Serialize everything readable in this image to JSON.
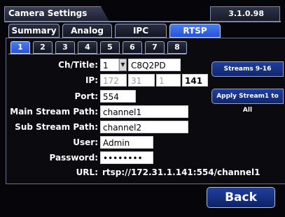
{
  "window": {
    "title": "Camera Settings",
    "version": "3.1.0.98"
  },
  "main_tabs": [
    {
      "label": "Summary"
    },
    {
      "label": "Analog"
    },
    {
      "label": "IPC"
    },
    {
      "label": "RTSP"
    }
  ],
  "active_main_tab": "RTSP",
  "channel_tabs": [
    "1",
    "2",
    "3",
    "4",
    "5",
    "6",
    "7",
    "8"
  ],
  "active_channel_tab": "1",
  "form": {
    "ch_title_label": "Ch/Title:",
    "ch_value": "1",
    "title_value": "C8Q2PD",
    "ip_label": "IP:",
    "ip_octets": [
      "172",
      "31",
      "1",
      "141"
    ],
    "port_label": "Port:",
    "port_value": "554",
    "main_stream_label": "Main Stream Path:",
    "main_stream_value": "channel1",
    "sub_stream_label": "Sub Stream Path:",
    "sub_stream_value": "channel2",
    "user_label": "User:",
    "user_value": "Admin",
    "password_label": "Password:",
    "password_value": "••••••••",
    "url_label": "URL:",
    "url_value": "rtsp://172.31.1.141:554/channel1"
  },
  "side_buttons": {
    "streams_label": "Streams 9-16",
    "apply_label": "Apply Stream1 to All"
  },
  "back_label": "Back",
  "colors": {
    "accent": "#2f5fe0",
    "button": "#1a3a9a",
    "background": "#06060a"
  }
}
